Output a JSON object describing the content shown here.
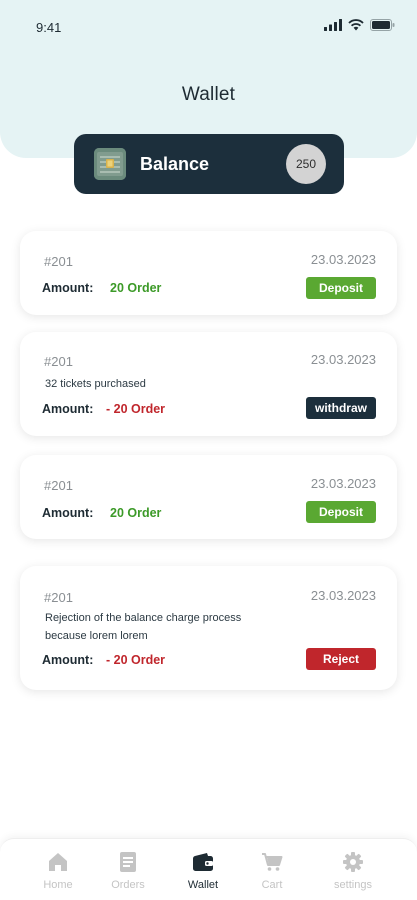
{
  "status_bar": {
    "time": "9:41"
  },
  "header": {
    "title": "Wallet"
  },
  "balance": {
    "label": "Balance",
    "value": "250"
  },
  "transactions": [
    {
      "id": "#201",
      "date": "23.03.2023",
      "description": "",
      "amount_label": "Amount:",
      "amount": "20 Order",
      "status": "Deposit",
      "status_color": "#5aa832",
      "amount_color": "#3c9a28"
    },
    {
      "id": "#201",
      "date": "23.03.2023",
      "description": "32 tickets purchased",
      "amount_label": "Amount:",
      "amount": "- 20 Order",
      "status": "withdraw",
      "status_color": "#1c2f3c",
      "amount_color": "#c0262c"
    },
    {
      "id": "#201",
      "date": "23.03.2023",
      "description": "",
      "amount_label": "Amount:",
      "amount": "20 Order",
      "status": "Deposit",
      "status_color": "#5aa832",
      "amount_color": "#3c9a28"
    },
    {
      "id": "#201",
      "date": "23.03.2023",
      "description": "Rejection of the balance charge process because lorem lorem",
      "amount_label": "Amount:",
      "amount": "- 20 Order",
      "status": "Reject",
      "status_color": "#c0262c",
      "amount_color": "#c0262c"
    }
  ],
  "tab_bar": {
    "items": [
      {
        "label": "Home",
        "icon": "home-icon",
        "active": false
      },
      {
        "label": "Orders",
        "icon": "orders-icon",
        "active": false
      },
      {
        "label": "Wallet",
        "icon": "wallet-icon",
        "active": true
      },
      {
        "label": "Cart",
        "icon": "cart-icon",
        "active": false
      },
      {
        "label": "settings",
        "icon": "gear-icon",
        "active": false
      }
    ]
  }
}
